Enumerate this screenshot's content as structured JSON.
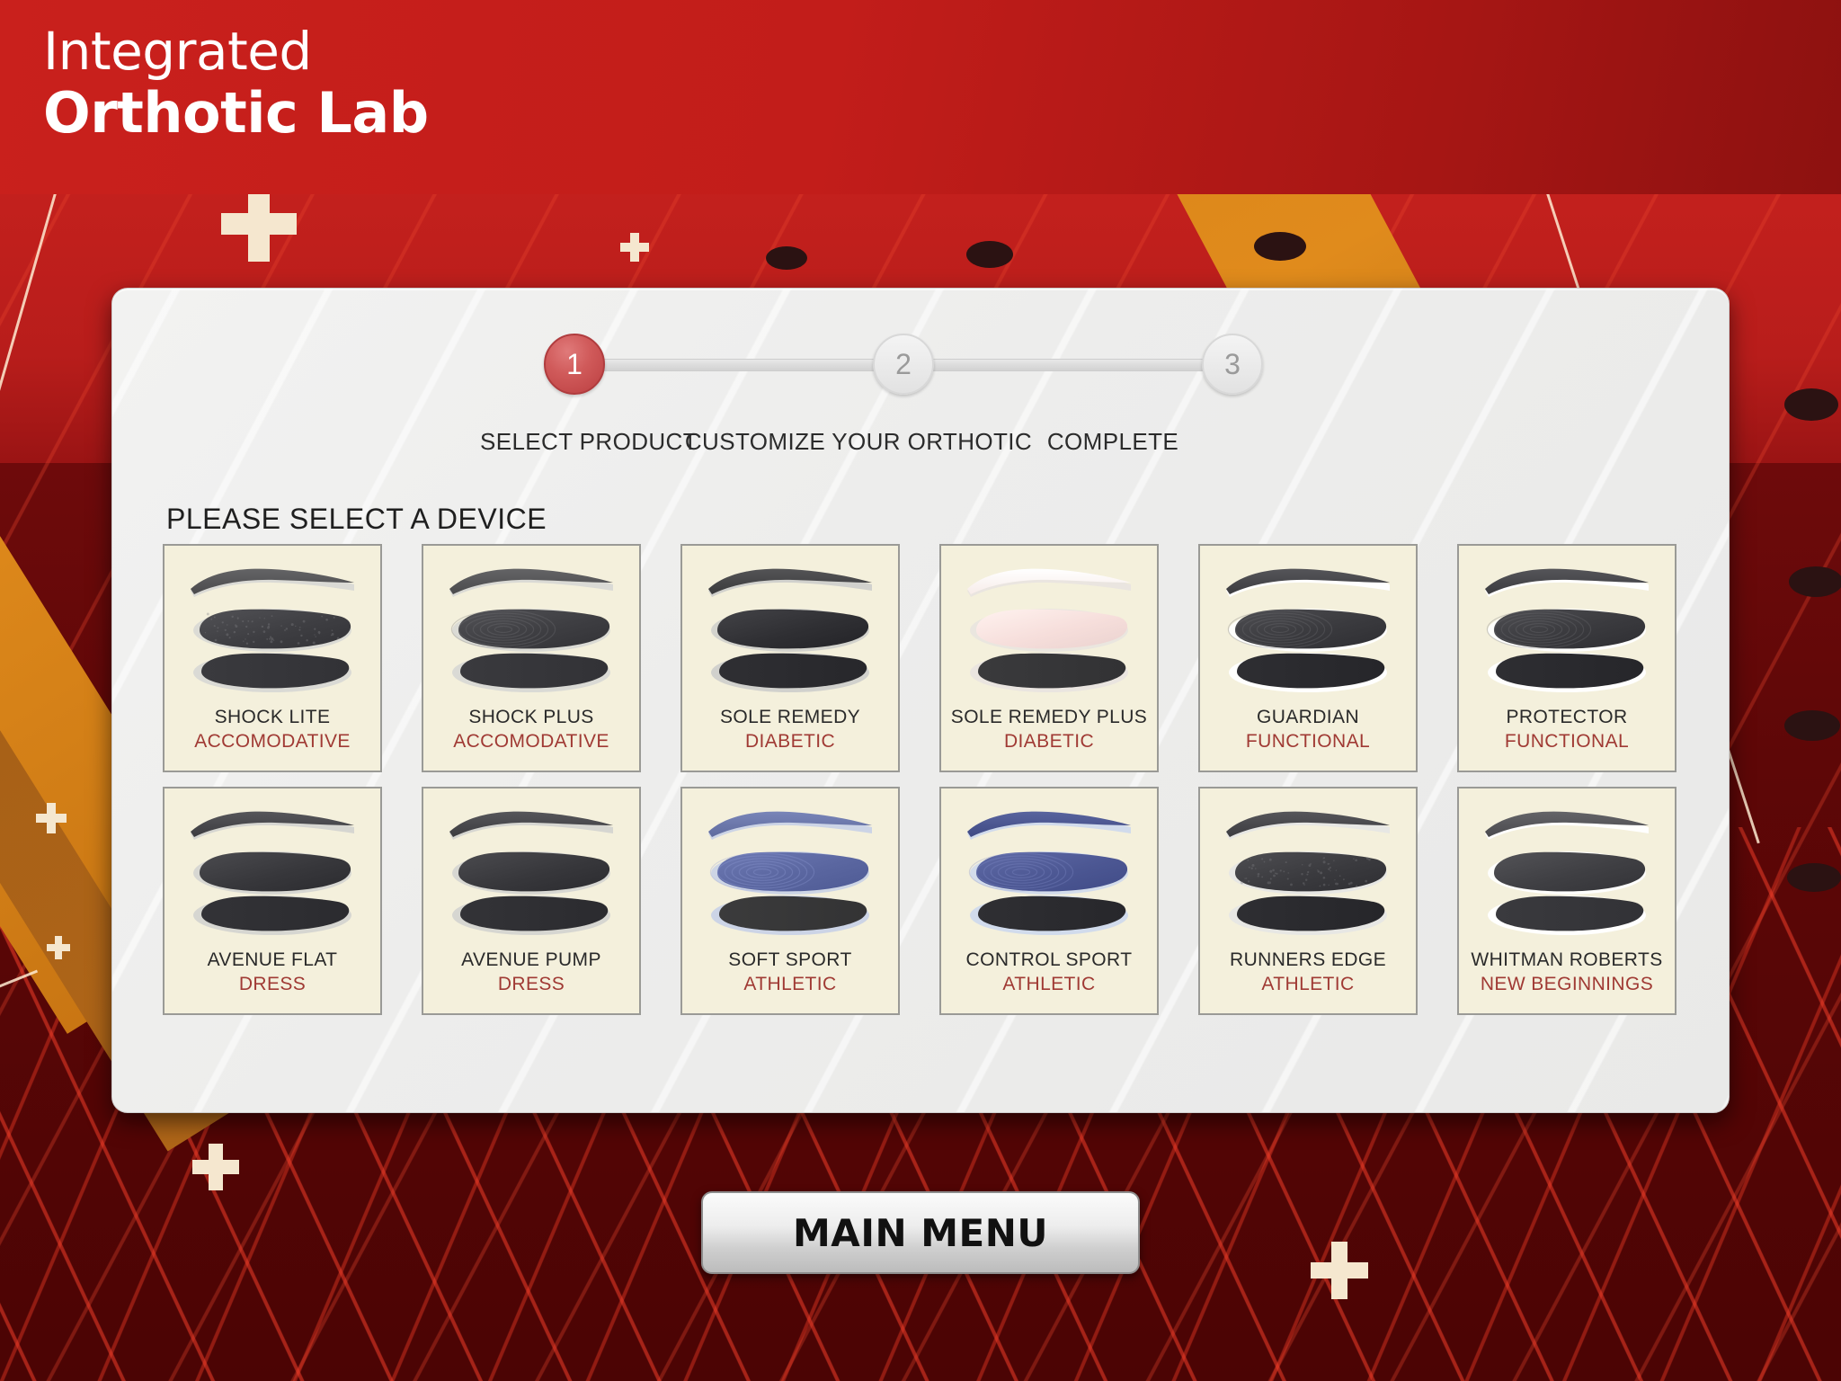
{
  "header": {
    "logo_line1": "Integrated",
    "logo_line2": "Orthotic Lab",
    "brand_red": "#c3201d"
  },
  "stepper": {
    "steps": [
      {
        "number": "1",
        "label": "SELECT PRODUCT",
        "state": "active"
      },
      {
        "number": "2",
        "label": "CUSTOMIZE YOUR ORTHOTIC",
        "state": "inactive"
      },
      {
        "number": "3",
        "label": "COMPLETE",
        "state": "inactive"
      }
    ],
    "active_color": "#c9504f",
    "inactive_color": "#e9e9e9"
  },
  "section": {
    "title": "PLEASE SELECT A DEVICE"
  },
  "products": [
    {
      "name": "SHOCK LITE",
      "category": "ACCOMODATIVE",
      "top_color": "#4a4a4c",
      "mid_color": "#3e3e42",
      "bot_color": "#3a3a3e",
      "sole_color": "#d8d8d4",
      "texture": "speckle"
    },
    {
      "name": "SHOCK PLUS",
      "category": "ACCOMODATIVE",
      "top_color": "#4a4a4c",
      "mid_color": "#3e3e42",
      "bot_color": "#3a3a3e",
      "sole_color": "#d8d8d4",
      "texture": "swirl"
    },
    {
      "name": "SOLE REMEDY",
      "category": "DIABETIC",
      "top_color": "#3a3a3c",
      "mid_color": "#2f2f33",
      "bot_color": "#2f2f33",
      "sole_color": "#cfcfcb",
      "texture": "plain"
    },
    {
      "name": "SOLE REMEDY PLUS",
      "category": "DIABETIC",
      "top_color": "#f7ece9",
      "mid_color": "#f6dedb",
      "bot_color": "#3a3a3c",
      "sole_color": "#e9e4df",
      "texture": "plain"
    },
    {
      "name": "GUARDIAN",
      "category": "FUNCTIONAL",
      "top_color": "#3b3b3f",
      "mid_color": "#3a3a3e",
      "bot_color": "#2e2e32",
      "sole_color": "#ffffff",
      "texture": "swirl"
    },
    {
      "name": "PROTECTOR",
      "category": "FUNCTIONAL",
      "top_color": "#3b3b3f",
      "mid_color": "#3a3a3e",
      "bot_color": "#2e2e32",
      "sole_color": "#ffffff",
      "texture": "swirl"
    },
    {
      "name": "AVENUE FLAT",
      "category": "DRESS",
      "top_color": "#3c3c40",
      "mid_color": "#37373b",
      "bot_color": "#333337",
      "sole_color": "#d4d4d0",
      "texture": "plain"
    },
    {
      "name": "AVENUE PUMP",
      "category": "DRESS",
      "top_color": "#3c3c40",
      "mid_color": "#37373b",
      "bot_color": "#333337",
      "sole_color": "#d4d4d0",
      "texture": "plain"
    },
    {
      "name": "SOFT SPORT",
      "category": "ATHLETIC",
      "top_color": "#5f6b9e",
      "mid_color": "#5a66a0",
      "bot_color": "#3b3b3c",
      "sole_color": "#c9d2e6",
      "texture": "swirl"
    },
    {
      "name": "CONTROL SPORT",
      "category": "ATHLETIC",
      "top_color": "#3f4a84",
      "mid_color": "#4c5793",
      "bot_color": "#2f2f33",
      "sole_color": "#cfd9ec",
      "texture": "swirl"
    },
    {
      "name": "RUNNERS EDGE",
      "category": "ATHLETIC",
      "top_color": "#3c3c40",
      "mid_color": "#3a3a3e",
      "bot_color": "#2e2e32",
      "sole_color": "#e6e6e4",
      "texture": "speckle"
    },
    {
      "name": "WHITMAN ROBERTS",
      "category": "NEW BEGINNINGS",
      "top_color": "#4a4a4e",
      "mid_color": "#3f3f43",
      "bot_color": "#3a3a3e",
      "sole_color": "#ffffff",
      "texture": "plain"
    }
  ],
  "footer": {
    "main_menu_label": "MAIN MENU"
  },
  "colors": {
    "card_bg": "#f4f0dc",
    "card_border": "#9a9a96",
    "category_text": "#a03a34",
    "panel_bg": "#ededec"
  }
}
